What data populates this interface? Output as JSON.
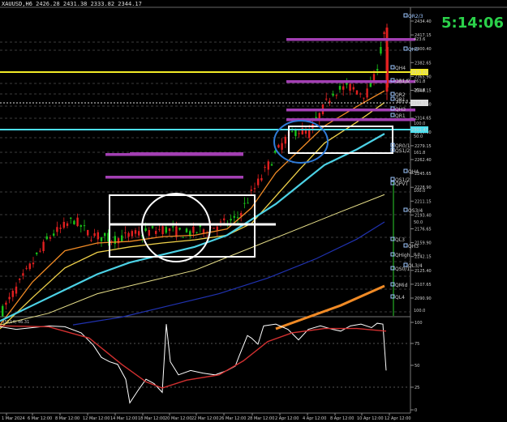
{
  "header": {
    "symbol": "XAUUSD,H6",
    "ohlc": "2426.28 2431.38 2333.82 2344.17",
    "tab_title": "XAUUSD,H6 (offline)"
  },
  "clock": "5:14:06",
  "price_axis": [
    "2434.40",
    "2417.15",
    "2400.40",
    "2382.65",
    "2365.90",
    "2348.15",
    "2331.40",
    "2314.65",
    "2296.90",
    "2279.15",
    "2262.40",
    "2245.65",
    "2228.90",
    "2211.15",
    "2193.40",
    "2176.65",
    "2159.90",
    "2142.15",
    "2125.40",
    "2107.65",
    "2090.90"
  ],
  "indicator_axis": [
    "100",
    "75",
    "50",
    "25",
    "0"
  ],
  "indicator_label": "RSI(14) 46.31",
  "time_axis": [
    "1 Mar 2024",
    "6 Mar 12:00",
    "8 Mar 12:00",
    "12 Mar 12:00",
    "14 Mar 12:00",
    "18 Mar 12:00",
    "20 Mar 12:00",
    "22 Mar 12:00",
    "26 Mar 12:00",
    "28 Mar 12:00",
    "2 Apr 12:00",
    "4 Apr 12:00",
    "8 Apr 12:00",
    "10 Apr 12:00",
    "12 Apr 12:00"
  ],
  "badges": {
    "yellow_price": "2371.01",
    "white_price": "2344.17",
    "cyan_price": "2301.47"
  },
  "level_labels": [
    {
      "text": "QR2/3",
      "color": "#9ec7ff"
    },
    {
      "text": "QH5",
      "color": "#9ec7ff"
    },
    {
      "text": "QH4",
      "color": "#ccc"
    },
    {
      "text": "QR1/2",
      "color": "#ccc"
    },
    {
      "text": "QR2",
      "color": "#ccc"
    },
    {
      "text": "QR1",
      "color": "#ccc"
    },
    {
      "text": "QH3",
      "color": "#ccc"
    },
    {
      "text": "QR1",
      "color": "#ccc"
    },
    {
      "text": "QR0/1",
      "color": "#ccc"
    },
    {
      "text": "QS1/2",
      "color": "#ccc"
    },
    {
      "text": "QH4",
      "color": "#ccc"
    },
    {
      "text": "QS1/2",
      "color": "#ccc"
    },
    {
      "text": "QPVT",
      "color": "#ccc"
    },
    {
      "text": "QS3/4",
      "color": "#ccc"
    },
    {
      "text": "QL3",
      "color": "#ccc"
    },
    {
      "text": "QH3",
      "color": "#ccc"
    },
    {
      "text": "QHigh",
      "color": "#ccc"
    },
    {
      "text": "QL3/4",
      "color": "#ccc"
    },
    {
      "text": "QS0/1",
      "color": "#ccc"
    },
    {
      "text": "QMid",
      "color": "#ccc"
    },
    {
      "text": "QL4",
      "color": "#ccc"
    }
  ],
  "fib_labels": [
    "423.6",
    "261.8",
    "161.8",
    "261.8",
    "161.8",
    "100.0",
    "50.0",
    "161.8",
    "100.0",
    "50.0",
    "0.0",
    "100.0"
  ],
  "colors": {
    "bull": "#19c219",
    "bear": "#e12020",
    "ma_orange": "#f08a25",
    "ma_yellow": "#f0d24a",
    "ma_cyan": "#4cd2e6",
    "ma_khaki": "#e8e08a",
    "ma_blue": "#2032b0",
    "ma_thick_orange": "#f08a25",
    "purple_bar": "#a33fb3",
    "yellow_line": "#f2ea27",
    "cyan_line": "#4de0f0",
    "rsi_line": "#ffffff",
    "rsi_ma": "#d23030"
  }
}
